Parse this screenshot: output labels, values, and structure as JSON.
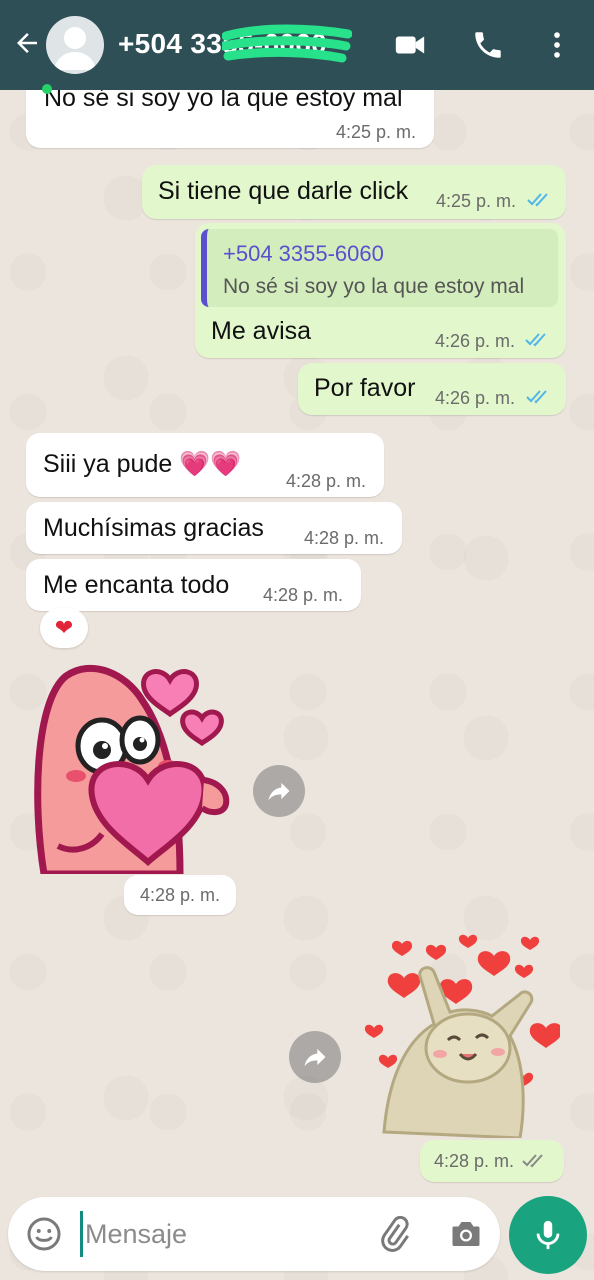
{
  "header": {
    "contact_name": "+504 3355-6060",
    "back_icon": "arrow-left-icon",
    "video_icon": "video-camera-icon",
    "call_icon": "phone-icon",
    "menu_icon": "more-vertical-icon"
  },
  "messages": [
    {
      "dir": "in",
      "text": "No sé si soy yo la que estoy mal",
      "time": "4:25 p. m."
    },
    {
      "dir": "out",
      "text": "Si tiene que darle click",
      "time": "4:25 p. m.",
      "status": "read"
    },
    {
      "dir": "out",
      "quote_author": "+504 3355-6060",
      "quote_text": "No sé si soy yo la que estoy mal",
      "text": "Me avisa",
      "time": "4:26 p. m.",
      "status": "read"
    },
    {
      "dir": "out",
      "text": "Por favor",
      "time": "4:26 p. m.",
      "status": "read"
    },
    {
      "dir": "in",
      "text": "Siii ya pude 💗💗",
      "time": "4:28 p. m."
    },
    {
      "dir": "in",
      "text": "Muchísimas gracias",
      "time": "4:28 p. m."
    },
    {
      "dir": "in",
      "text": "Me encanta todo",
      "time": "4:28 p. m.",
      "reaction": "❤"
    },
    {
      "dir": "in",
      "type": "sticker",
      "sticker": "patrick-with-heart",
      "time": "4:28 p. m."
    },
    {
      "dir": "out",
      "type": "sticker",
      "sticker": "cat-with-hearts",
      "time": "4:28 p. m.",
      "status": "delivered"
    }
  ],
  "composer": {
    "placeholder": "Mensaje",
    "emoji_icon": "emoji-icon",
    "attach_icon": "paperclip-icon",
    "camera_icon": "camera-icon",
    "mic_icon": "microphone-icon"
  },
  "colors": {
    "header": "#2f4f56",
    "outgoing_bubble": "#e2f7cb",
    "incoming_bubble": "#ffffff",
    "read_ticks": "#4fb6ec",
    "accent": "#1aa37f"
  }
}
